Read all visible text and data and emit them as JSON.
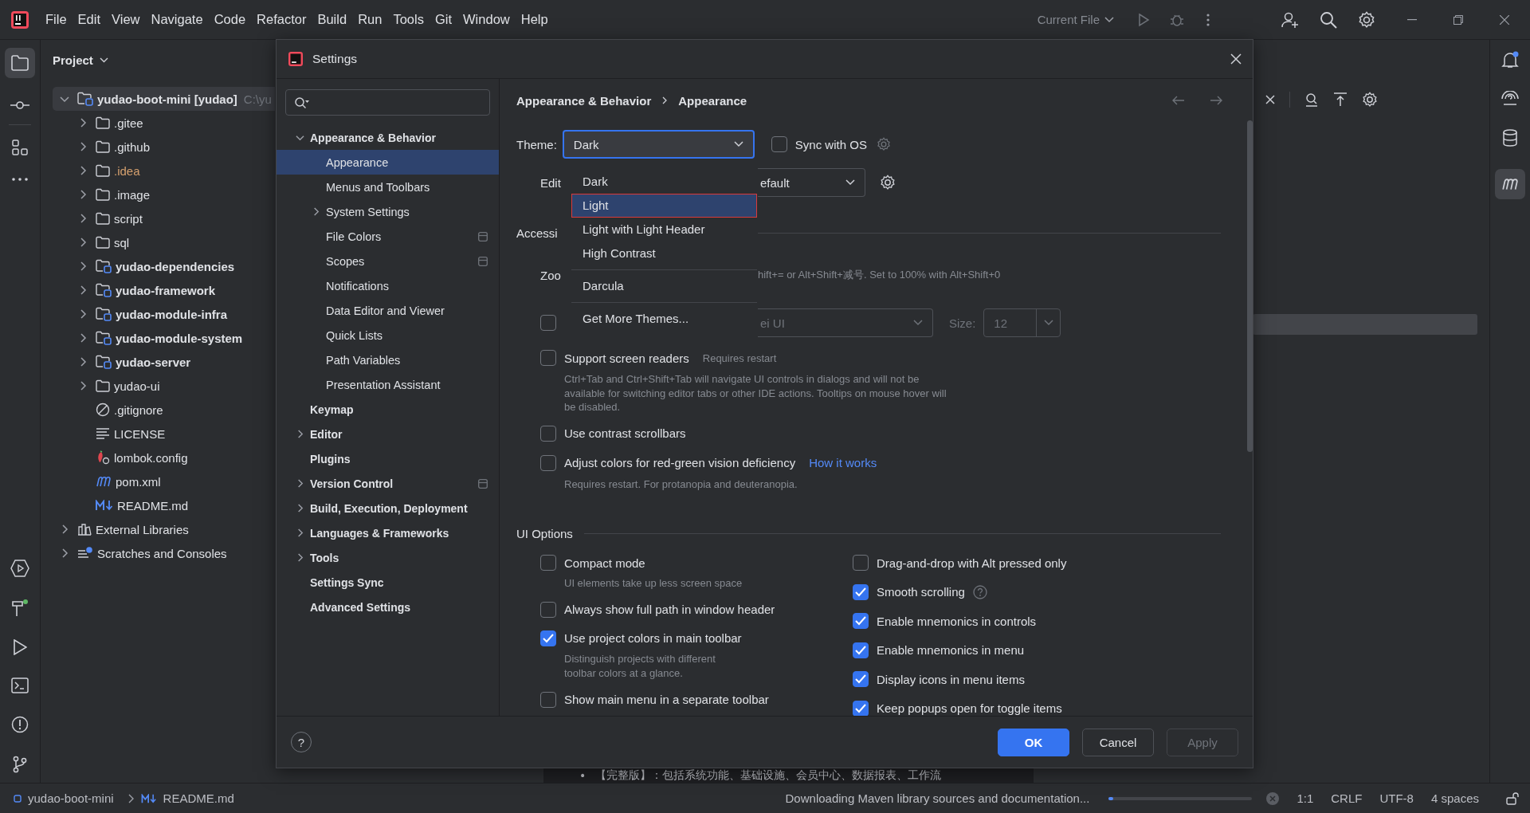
{
  "menu_bar": {
    "items": [
      "File",
      "Edit",
      "View",
      "Navigate",
      "Code",
      "Refactor",
      "Build",
      "Run",
      "Tools",
      "Git",
      "Window",
      "Help"
    ],
    "run_config": "Current File"
  },
  "project_panel": {
    "title": "Project",
    "tree": [
      {
        "label": "yudao-boot-mini **[yudao]**",
        "path": "C:\\yu",
        "kind": "module",
        "expanded": true,
        "children": [
          {
            "label": ".gitee",
            "kind": "folder",
            "expanded": false
          },
          {
            "label": ".github",
            "kind": "folder",
            "expanded": false
          },
          {
            "label": ".idea",
            "kind": "config-folder",
            "expanded": false
          },
          {
            "label": ".image",
            "kind": "folder",
            "expanded": false
          },
          {
            "label": "script",
            "kind": "folder",
            "expanded": false
          },
          {
            "label": "sql",
            "kind": "folder",
            "expanded": false
          },
          {
            "label": "yudao-dependencies",
            "kind": "module",
            "expanded": false
          },
          {
            "label": "yudao-framework",
            "kind": "module",
            "expanded": false
          },
          {
            "label": "yudao-module-infra",
            "kind": "module",
            "expanded": false
          },
          {
            "label": "yudao-module-system",
            "kind": "module",
            "expanded": false
          },
          {
            "label": "yudao-server",
            "kind": "module",
            "expanded": false
          },
          {
            "label": "yudao-ui",
            "kind": "folder",
            "expanded": false
          },
          {
            "label": ".gitignore",
            "kind": "ignore"
          },
          {
            "label": "LICENSE",
            "kind": "text"
          },
          {
            "label": "lombok.config",
            "kind": "config"
          },
          {
            "label": "pom.xml",
            "kind": "maven"
          },
          {
            "label": "README.md",
            "kind": "markdown"
          }
        ]
      },
      {
        "label": "External Libraries",
        "kind": "libraries",
        "expanded": false
      },
      {
        "label": "Scratches and Consoles",
        "kind": "scratches",
        "expanded": false
      }
    ]
  },
  "editor": {
    "markdown_line": {
      "bullet": "•",
      "text": "【完整版】：包括系统功能、基础设施、会员中心、数据报表、工作流"
    }
  },
  "settings": {
    "title": "Settings",
    "nav": [
      {
        "label": "Appearance & Behavior",
        "selected": false,
        "expanded": true,
        "children": [
          {
            "label": "Appearance",
            "selected": true
          },
          {
            "label": "Menus and Toolbars",
            "selected": false
          },
          {
            "label": "System Settings",
            "selected": false,
            "expanded": false
          },
          {
            "label": "File Colors",
            "selected": false,
            "project_level": true
          },
          {
            "label": "Scopes",
            "selected": false,
            "project_level": true
          },
          {
            "label": "Notifications",
            "selected": false
          },
          {
            "label": "Data Editor and Viewer",
            "selected": false
          },
          {
            "label": "Quick Lists",
            "selected": false
          },
          {
            "label": "Path Variables",
            "selected": false
          },
          {
            "label": "Presentation Assistant",
            "selected": false
          }
        ]
      },
      {
        "label": "Keymap",
        "selected": false
      },
      {
        "label": "Editor",
        "selected": false,
        "expanded": false
      },
      {
        "label": "Plugins",
        "selected": false
      },
      {
        "label": "Version Control",
        "selected": false,
        "expanded": false,
        "project_level": true
      },
      {
        "label": "Build, Execution, Deployment",
        "selected": false,
        "expanded": false
      },
      {
        "label": "Languages & Frameworks",
        "selected": false,
        "expanded": false
      },
      {
        "label": "Tools",
        "selected": false,
        "expanded": false
      },
      {
        "label": "Settings Sync",
        "selected": false
      },
      {
        "label": "Advanced Settings",
        "selected": false
      }
    ],
    "breadcrumb": [
      "Appearance & Behavior",
      "Appearance"
    ],
    "theme": {
      "label": "Theme:",
      "value": "Dark",
      "option_groups": [
        [
          {
            "label": "Dark",
            "selected": false
          },
          {
            "label": "Light",
            "selected": true
          },
          {
            "label": "Light with Light Header",
            "selected": false
          },
          {
            "label": "High Contrast",
            "selected": false
          }
        ],
        [
          {
            "label": "Darcula",
            "selected": false
          }
        ],
        [
          {
            "label": "Get More Themes...",
            "selected": false
          }
        ]
      ]
    },
    "sync_with_os": {
      "label": "Sync with OS",
      "checked": false
    },
    "editor_scheme": {
      "label": "Edit",
      "value": "efault"
    },
    "accessibility": {
      "title": "Accessi"
    },
    "zoom": {
      "label": "Zoo",
      "hint": "hift+= or Alt+Shift+减号. Set to 100% with Alt+Shift+0"
    },
    "custom_font": {
      "checked": false,
      "font": "ei UI",
      "size_label": "Size:",
      "size": "12"
    },
    "accessibility_options": [
      {
        "label": "Support screen readers",
        "checked": false,
        "note": "Requires restart",
        "description": "Ctrl+Tab and Ctrl+Shift+Tab will navigate UI controls in dialogs and will not be available for switching editor tabs or other IDE actions. Tooltips on mouse hover will be disabled."
      },
      {
        "label": "Use contrast scrollbars",
        "checked": false
      },
      {
        "label": "Adjust colors for red-green vision deficiency",
        "checked": false,
        "link": "How it works",
        "description": "Requires restart. For protanopia and deuteranopia."
      }
    ],
    "ui_options": {
      "title": "UI Options",
      "left": [
        {
          "label": "Compact mode",
          "checked": false,
          "description": "UI elements take up less screen space"
        },
        {
          "label": "Always show full path in window header",
          "checked": false
        },
        {
          "label": "Use project colors in main toolbar",
          "checked": true,
          "description": "Distinguish projects with different toolbar colors at a glance."
        },
        {
          "label": "Show main menu in a separate toolbar",
          "checked": false
        }
      ],
      "right": [
        {
          "label": "Drag-and-drop with Alt pressed only",
          "checked": false
        },
        {
          "label": "Smooth scrolling",
          "checked": true,
          "help": true
        },
        {
          "label": "Enable mnemonics in controls",
          "checked": true
        },
        {
          "label": "Enable mnemonics in menu",
          "checked": true
        },
        {
          "label": "Display icons in menu items",
          "checked": true
        },
        {
          "label": "Keep popups open for toggle items",
          "checked": true
        }
      ]
    },
    "help": "?",
    "buttons": [
      {
        "label": "OK",
        "kind": "primary"
      },
      {
        "label": "Cancel",
        "kind": "normal"
      },
      {
        "label": "Apply",
        "kind": "disabled"
      }
    ]
  },
  "status_bar": {
    "breadcrumb": [
      "yudao-boot-mini",
      "README.md"
    ],
    "task": "Downloading Maven library sources and documentation...",
    "progress": {
      "level": 0.03
    },
    "caret": "1:1",
    "line_ending": "CRLF",
    "encoding": "UTF-8",
    "indent": "4 spaces"
  }
}
